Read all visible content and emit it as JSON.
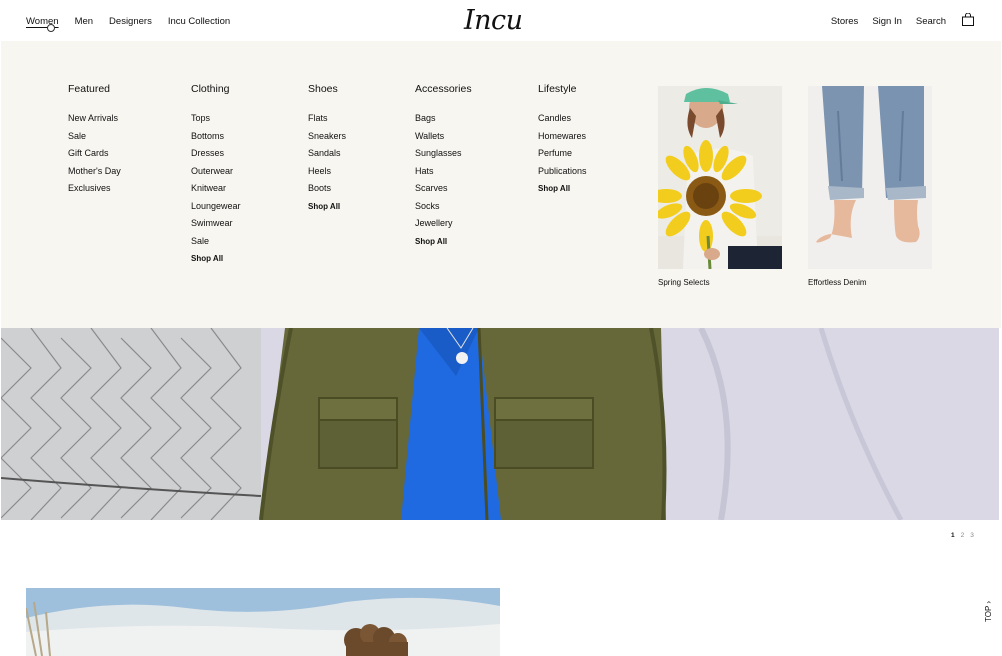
{
  "header": {
    "nav_left": [
      "Women",
      "Men",
      "Designers",
      "Incu Collection"
    ],
    "logo": "Incu",
    "nav_right": [
      "Stores",
      "Sign In",
      "Search"
    ],
    "bag_icon": "shopping-bag-icon"
  },
  "menu": {
    "columns": [
      {
        "title": "Featured",
        "items": [
          "New Arrivals",
          "Sale",
          "Gift Cards",
          "Mother's Day",
          "Exclusives"
        ]
      },
      {
        "title": "Clothing",
        "items": [
          "Tops",
          "Bottoms",
          "Dresses",
          "Outerwear",
          "Knitwear",
          "Loungewear",
          "Swimwear",
          "Sale"
        ],
        "shop_all": "Shop All"
      },
      {
        "title": "Shoes",
        "items": [
          "Flats",
          "Sneakers",
          "Sandals",
          "Heels",
          "Boots"
        ],
        "shop_all": "Shop All"
      },
      {
        "title": "Accessories",
        "items": [
          "Bags",
          "Wallets",
          "Sunglasses",
          "Hats",
          "Scarves",
          "Socks",
          "Jewellery"
        ],
        "shop_all": "Shop All"
      },
      {
        "title": "Lifestyle",
        "items": [
          "Candles",
          "Homewares",
          "Perfume",
          "Publications"
        ],
        "shop_all": "Shop All"
      }
    ],
    "promos": [
      {
        "caption": "Spring Selects"
      },
      {
        "caption": "Effortless Denim"
      }
    ]
  },
  "pager": [
    "1",
    "2",
    "3"
  ],
  "top_link": "TOP"
}
